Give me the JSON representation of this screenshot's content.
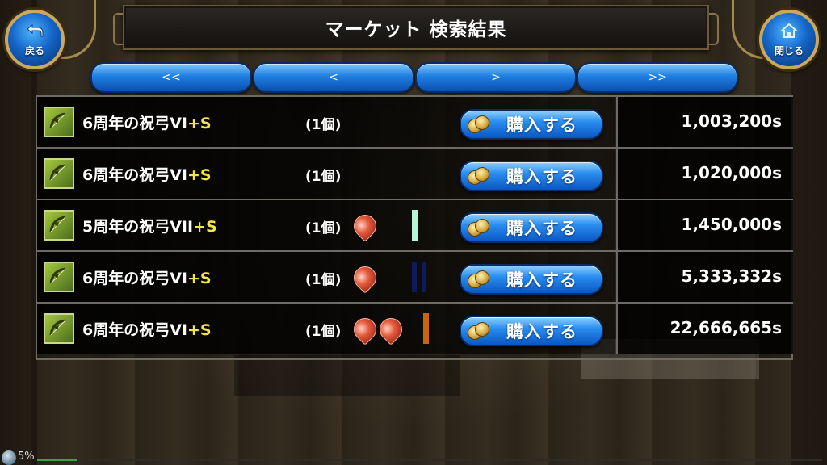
{
  "header": {
    "title": "マーケット 検索結果",
    "back_label": "戻る",
    "close_label": "閉じる"
  },
  "pagination": {
    "first": "<<",
    "prev": "<",
    "next": ">",
    "last": ">>"
  },
  "rows": [
    {
      "name": "6周年の祝弓VI",
      "plus": "+S",
      "qty": "(1個)",
      "gems": 0,
      "marker": "",
      "buy": "購入する",
      "price": "1,003,200s"
    },
    {
      "name": "6周年の祝弓VI",
      "plus": "+S",
      "qty": "(1個)",
      "gems": 0,
      "marker": "",
      "buy": "購入する",
      "price": "1,020,000s"
    },
    {
      "name": "5周年の祝弓VII",
      "plus": "+S",
      "qty": "(1個)",
      "gems": 1,
      "marker": "mint",
      "buy": "購入する",
      "price": "1,450,000s"
    },
    {
      "name": "6周年の祝弓VI",
      "plus": "+S",
      "qty": "(1個)",
      "gems": 1,
      "marker": "navy",
      "buy": "購入する",
      "price": "5,333,332s"
    },
    {
      "name": "6周年の祝弓VI",
      "plus": "+S",
      "qty": "(1個)",
      "gems": 2,
      "marker": "orange",
      "buy": "購入する",
      "price": "22,666,665s"
    }
  ],
  "marker_colors": {
    "mint": "#b6f5d6",
    "navy": "#0e1a5c",
    "orange": "#c8660e"
  },
  "status": {
    "percent_label": "5%",
    "progress": 0.05
  },
  "icons": {
    "back": "return-arrow-icon",
    "close": "home-icon",
    "item": "bow-icon",
    "gem": "fire-gem-icon",
    "coin": "coins-icon"
  }
}
